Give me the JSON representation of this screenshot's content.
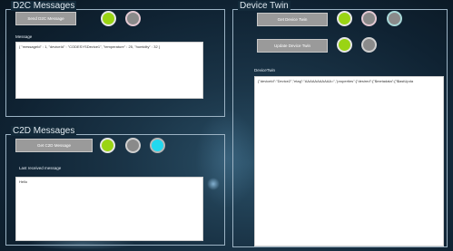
{
  "d2c": {
    "title": "D2C Messages",
    "send_button": "Send D2C Message",
    "message_label": "Message",
    "message_value": "{ \"messageId\" : 1, \"deviceId\" : \"CODESYSDevice1\", \"temperature\" : 25, \"humidity\" : 32 }"
  },
  "c2d": {
    "title": "C2D Messages",
    "get_button": "Get C2D Message",
    "last_label": "Last received message",
    "last_value": "Hello"
  },
  "twin": {
    "title": "Device Twin",
    "get_button": "Get Device Twin",
    "update_button": "Update Device Twin",
    "twin_label": "DeviceTwin",
    "twin_value": "{\"deviceId\":\"Device2\",\"etag\":\"AAAAAAAAAAA=\",\"properties\":{\"desired\":{\"$metadata\":{\"$lastUpda"
  },
  "colors": {
    "led_green": "#9ad414",
    "led_cyan": "#22d8ef",
    "led_gray": "#8a8a8a"
  }
}
